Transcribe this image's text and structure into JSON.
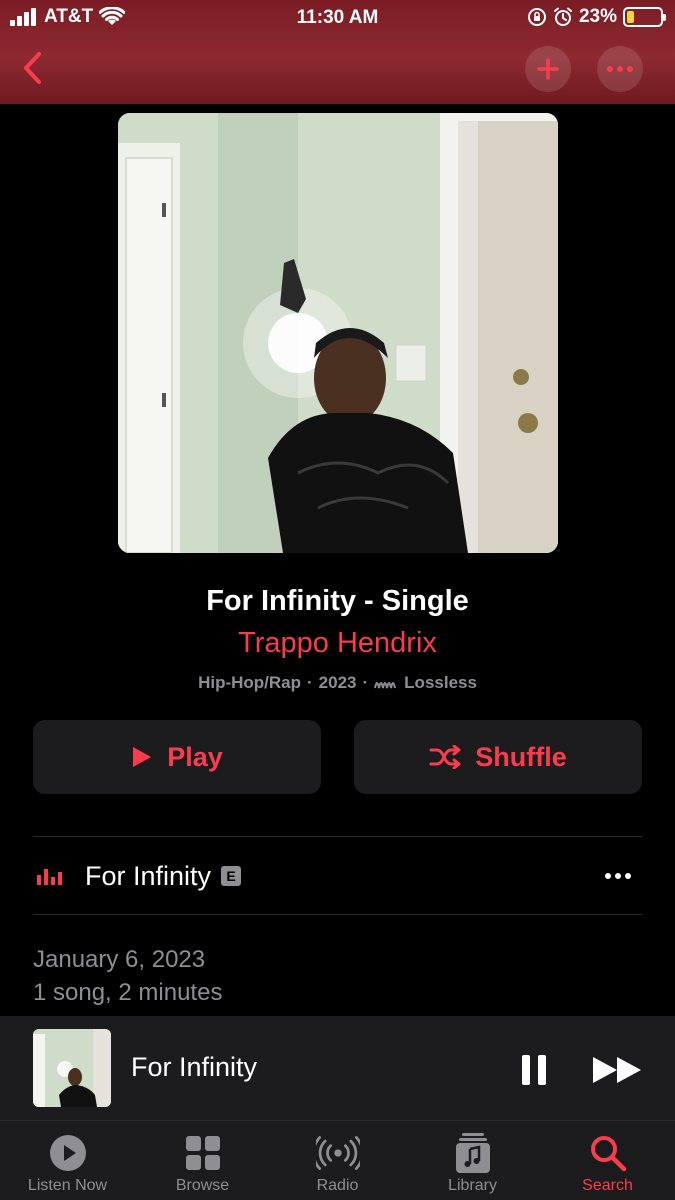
{
  "status_bar": {
    "carrier": "AT&T",
    "time": "11:30 AM",
    "battery_percent": "23%",
    "battery_level": 0.23,
    "battery_color": "#f5d33b"
  },
  "nav": {
    "back_icon": "chevron-left-icon",
    "add_icon": "plus-icon",
    "more_icon": "ellipsis-icon"
  },
  "album": {
    "title": "For Infinity - Single",
    "artist": "Trappo Hendrix",
    "genre": "Hip-Hop/Rap",
    "year": "2023",
    "quality": "Lossless",
    "separator": "·"
  },
  "actions": {
    "play_label": "Play",
    "shuffle_label": "Shuffle"
  },
  "tracks": [
    {
      "title": "For Infinity",
      "explicit": "E",
      "playing": true
    }
  ],
  "release": {
    "date": "January 6, 2023",
    "summary": "1 song, 2 minutes"
  },
  "mini_player": {
    "title": "For Infinity"
  },
  "tabs": [
    {
      "label": "Listen Now",
      "icon": "play-circle-icon",
      "active": false
    },
    {
      "label": "Browse",
      "icon": "grid-icon",
      "active": false
    },
    {
      "label": "Radio",
      "icon": "radio-waves-icon",
      "active": false
    },
    {
      "label": "Library",
      "icon": "library-icon",
      "active": false
    },
    {
      "label": "Search",
      "icon": "search-icon",
      "active": true
    }
  ],
  "colors": {
    "accent": "#fa3c4c",
    "header_gradient": "#8e2a30",
    "surface": "#1c1c1e",
    "secondary_text": "#8e8e93"
  }
}
